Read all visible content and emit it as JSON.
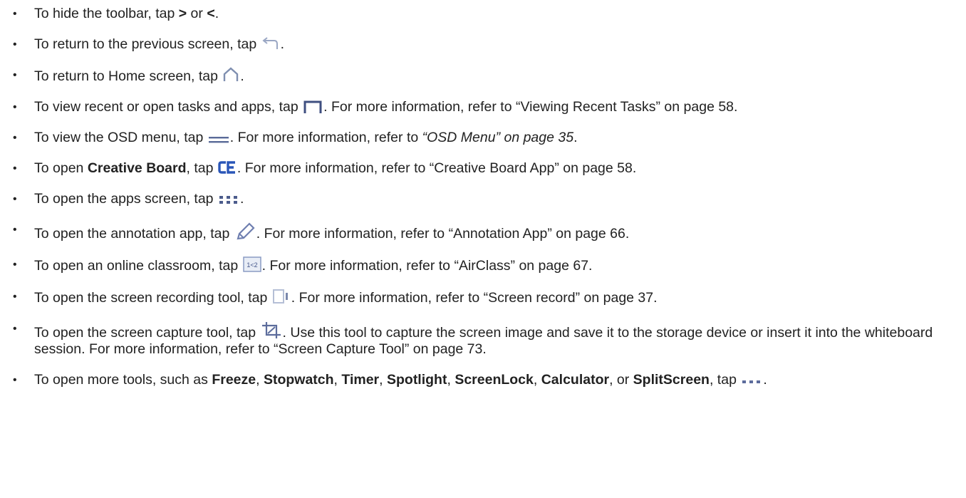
{
  "items": [
    {
      "icon": "chevron-arrows-text",
      "parts": [
        "To hide the toolbar, tap ",
        ">",
        " or ",
        "<",
        "."
      ]
    },
    {
      "icon": "back-arrow-icon",
      "parts": [
        "To return to the previous screen, tap ",
        "."
      ]
    },
    {
      "icon": "home-icon",
      "parts": [
        "To return to Home screen, tap ",
        "."
      ]
    },
    {
      "icon": "recent-tasks-icon",
      "parts": [
        "To view recent or open tasks and apps, tap ",
        ". For more information, refer to “Viewing Recent Tasks” on page 58."
      ]
    },
    {
      "icon": "osd-menu-icon",
      "parts": [
        "To view the OSD menu, tap ",
        ". For more information, refer to ",
        "“OSD Menu” on page 35",
        "."
      ]
    },
    {
      "icon": "creative-board-icon",
      "parts": [
        "To open ",
        "Creative Board",
        ", tap ",
        ". For more information, refer to “Creative Board App” on page 58."
      ]
    },
    {
      "icon": "apps-grid-icon",
      "parts": [
        "To open the apps screen, tap ",
        "."
      ]
    },
    {
      "icon": "pen-icon",
      "parts": [
        "To open the annotation app, tap ",
        ". For more information, refer to “Annotation App” on page 66."
      ]
    },
    {
      "icon": "airclass-icon",
      "icon_text": "1<2",
      "parts": [
        "To open an online classroom, tap ",
        ". For more information, refer to “AirClass” on page 67."
      ]
    },
    {
      "icon": "screen-record-icon",
      "parts": [
        "To open the screen recording tool, tap ",
        ". For more information, refer to “Screen record” on page 37."
      ]
    },
    {
      "icon": "screen-capture-icon",
      "parts": [
        "To open the screen capture tool, tap ",
        ". Use this tool to capture the screen image and save it to the storage device or insert it into the whiteboard session. For more information, refer to “Screen Capture Tool” on page 73."
      ]
    },
    {
      "icon": "more-tools-icon",
      "parts": [
        "To open more tools, such as ",
        "Freeze",
        ", ",
        "Stopwatch",
        ", ",
        "Timer",
        ", ",
        "Spotlight",
        ", ",
        "ScreenLock",
        ", ",
        "Calculator",
        ", or ",
        "SplitScreen",
        ", tap ",
        "."
      ]
    }
  ]
}
